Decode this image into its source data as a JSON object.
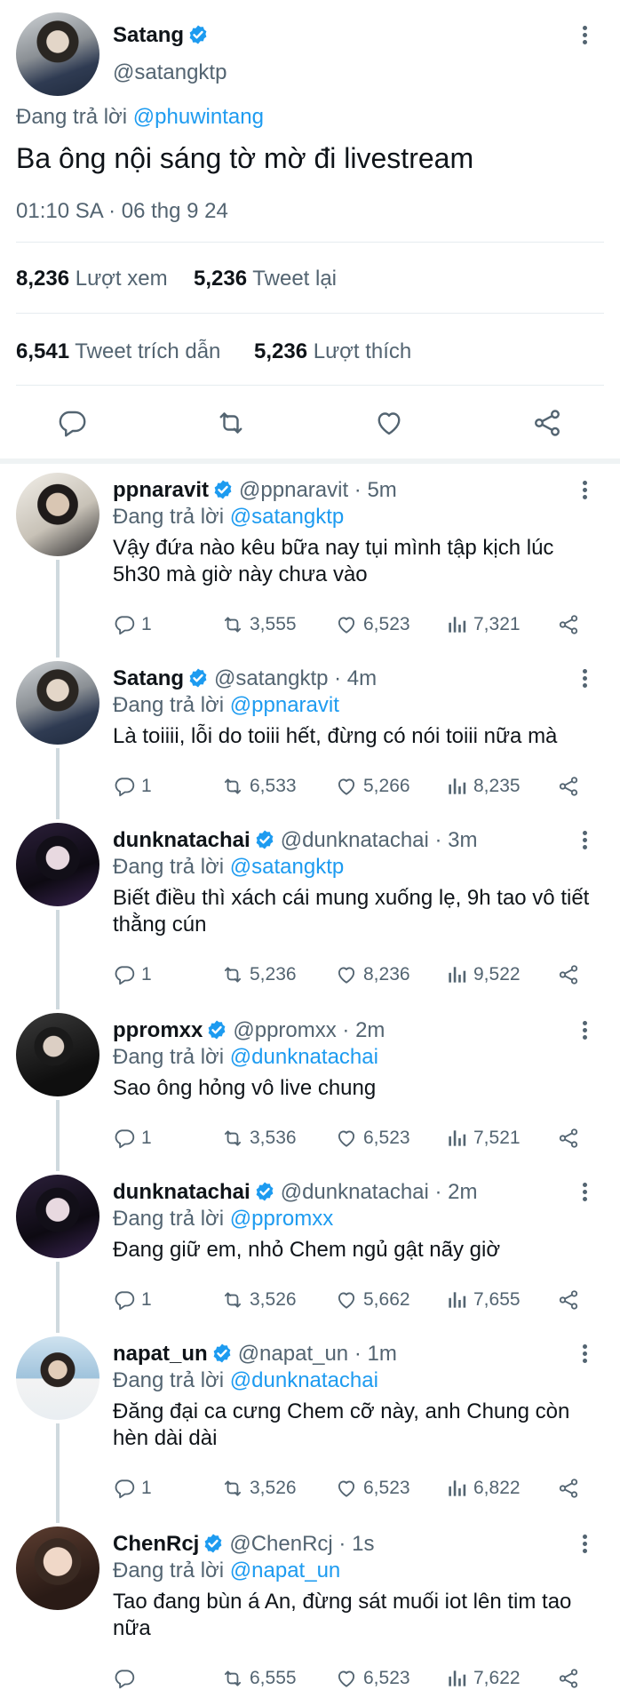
{
  "main_tweet": {
    "name": "Satang",
    "handle": "@satangktp",
    "reply_prefix": "Đang trả lời ",
    "reply_to": "@phuwintang",
    "text": "Ba ông nội sáng tờ mờ đi livestream",
    "timestamp": "01:10 SA · 06 thg 9 24",
    "views_count": "8,236",
    "views_label": "Lượt xem",
    "retweets_count": "5,236",
    "retweets_label": "Tweet lại",
    "quotes_count": "6,541",
    "quotes_label": "Tweet trích dẫn",
    "likes_count": "5,236",
    "likes_label": "Lượt thích"
  },
  "colors": {
    "accent": "#1d9bf0",
    "secondary_text": "#536471",
    "primary_text": "#0f1419"
  },
  "replies": [
    {
      "name": "ppnaravit",
      "handle": "@ppnaravit · 5m",
      "reply_prefix": "Đang trả lời ",
      "reply_to": "@satangktp",
      "text": "Vậy đứa nào kêu bữa nay tụi mình tập kịch lúc 5h30 mà giờ này chưa vào",
      "replies": "1",
      "retweets": "3,555",
      "likes": "6,523",
      "views": "7,321"
    },
    {
      "name": "Satang",
      "handle": "@satangktp · 4m",
      "reply_prefix": "Đang trả lời ",
      "reply_to": "@ppnaravit",
      "text": "Là toiiii, lỗi do toiii hết, đừng có nói toiii nữa mà",
      "replies": "1",
      "retweets": "6,533",
      "likes": "5,266",
      "views": "8,235"
    },
    {
      "name": "dunknatachai",
      "handle": "@dunknatachai · 3m",
      "reply_prefix": "Đang trả lời ",
      "reply_to": "@satangktp",
      "text": "Biết điều thì xách cái mung xuống lẹ, 9h tao vô tiết thằng cún",
      "replies": "1",
      "retweets": "5,236",
      "likes": "8,236",
      "views": "9,522"
    },
    {
      "name": "ppromxx",
      "handle": "@ppromxx · 2m",
      "reply_prefix": "Đang trả lời ",
      "reply_to": "@dunknatachai",
      "text": "Sao ông hỏng vô live chung",
      "replies": "1",
      "retweets": "3,536",
      "likes": "6,523",
      "views": "7,521"
    },
    {
      "name": "dunknatachai",
      "handle": "@dunknatachai · 2m",
      "reply_prefix": "Đang trả lời ",
      "reply_to": "@ppromxx",
      "text": "Đang giữ em, nhỏ Chem ngủ gật nãy giờ",
      "replies": "1",
      "retweets": "3,526",
      "likes": "5,662",
      "views": "7,655"
    },
    {
      "name": "napat_un",
      "handle": "@napat_un · 1m",
      "reply_prefix": "Đang trả lời ",
      "reply_to": "@dunknatachai",
      "text": "Đăng đại ca cưng Chem cỡ này, anh Chung còn hèn dài dài",
      "replies": "1",
      "retweets": "3,526",
      "likes": "6,523",
      "views": "6,822"
    },
    {
      "name": "ChenRcj",
      "handle": "@ChenRcj · 1s",
      "reply_prefix": "Đang trả lời ",
      "reply_to": "@napat_un",
      "text": "Tao đang bùn á An, đừng sát muối iot lên tim tao nữa",
      "replies": "",
      "retweets": "6,555",
      "likes": "6,523",
      "views": "7,622"
    }
  ]
}
